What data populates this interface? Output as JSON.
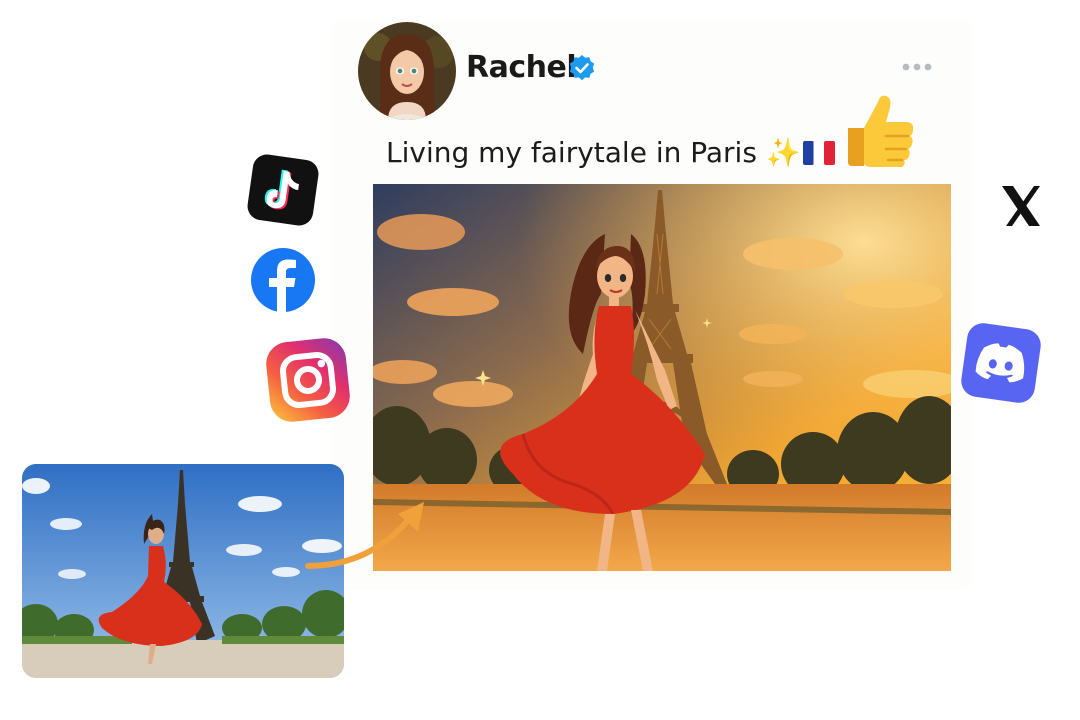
{
  "post": {
    "username": "Rachel",
    "verified_icon": "verified-badge-icon",
    "caption": "Living my fairytale in Paris",
    "caption_emoji": "✨",
    "flag_icon": "france-flag-icon",
    "more_icon": "more-options-icon",
    "reaction_icon": "thumbs-up-icon",
    "image_subject": "cartoon-eiffel-tower-girl-red-dress"
  },
  "social_icons": [
    "tiktok-icon",
    "facebook-icon",
    "instagram-icon",
    "x-icon",
    "discord-icon"
  ],
  "source_photo": {
    "subject": "photo-eiffel-tower-woman-red-dress",
    "arrow_icon": "curved-arrow-icon"
  },
  "colors": {
    "verified": "#1d9bf0",
    "facebook": "#1877f2",
    "discord": "#5865f2",
    "tiktok_bg": "#111111",
    "arrow": "#f0a13a",
    "dress": "#d9301c"
  }
}
